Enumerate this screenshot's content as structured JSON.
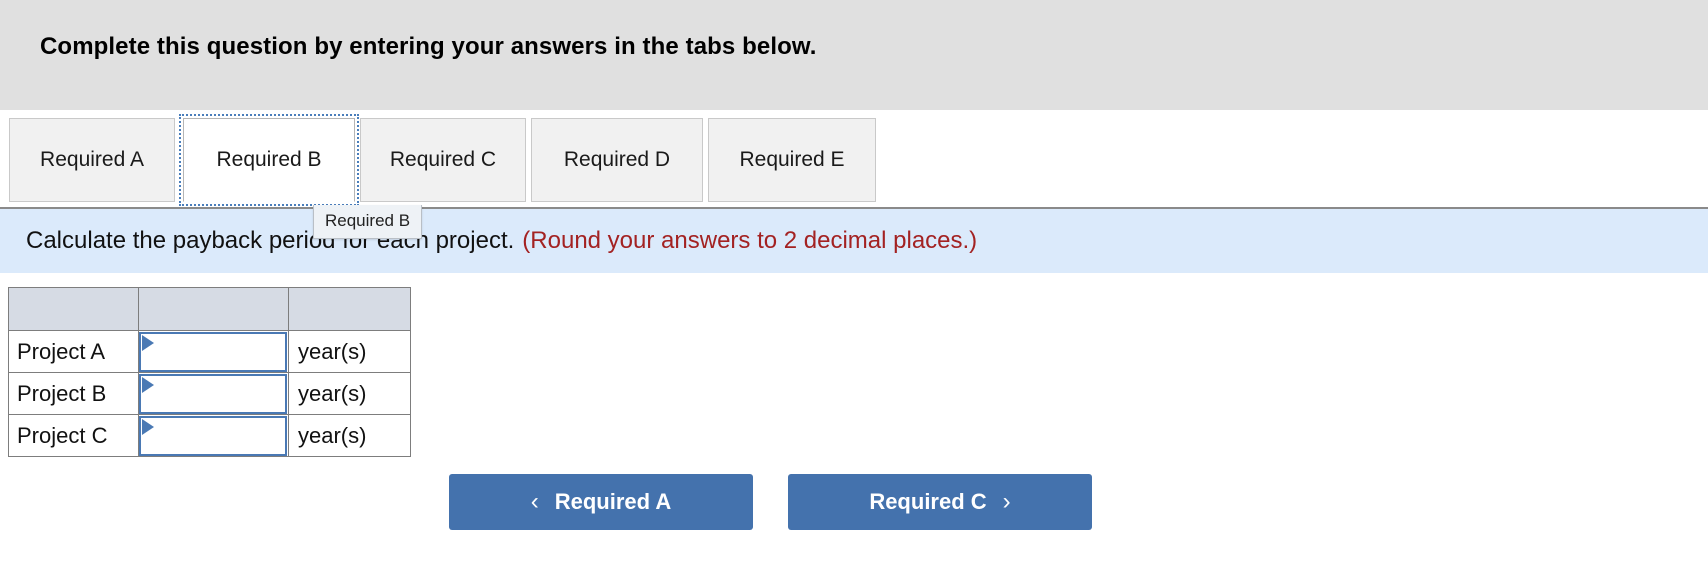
{
  "header": {
    "title": "Complete this question by entering your answers in the tabs below."
  },
  "tabs": {
    "items": [
      {
        "label": "Required A",
        "active": false
      },
      {
        "label": "Required B",
        "active": true
      },
      {
        "label": "Required C",
        "active": false
      },
      {
        "label": "Required D",
        "active": false
      },
      {
        "label": "Required E",
        "active": false
      }
    ],
    "tooltip": "Required B"
  },
  "instruction": {
    "text": "Calculate the payback period for each project.",
    "note": "(Round your answers to 2 decimal places.)"
  },
  "table": {
    "header": [
      ""
    ],
    "rows": [
      {
        "label": "Project A",
        "value": "",
        "unit": "year(s)"
      },
      {
        "label": "Project B",
        "value": "",
        "unit": "year(s)"
      },
      {
        "label": "Project C",
        "value": "",
        "unit": "year(s)"
      }
    ]
  },
  "nav": {
    "prev_label": "Required A",
    "prev_icon": "chevron-left",
    "next_label": "Required C",
    "next_icon": "chevron-right"
  },
  "colors": {
    "header_bg": "#e0e0e0",
    "instruction_bg": "#dbeafb",
    "note_red": "#a32222",
    "button_blue": "#4472ad",
    "table_header_bg": "#d6dbe4",
    "input_border": "#4a79b4"
  }
}
